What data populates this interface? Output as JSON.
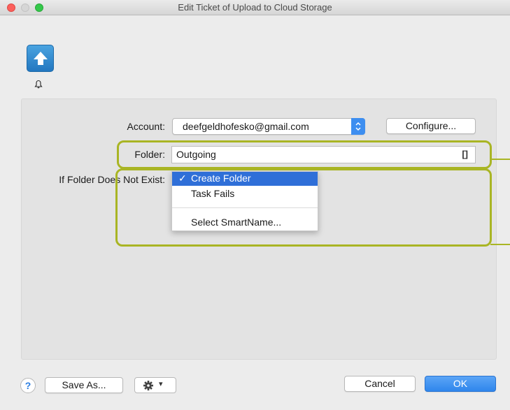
{
  "window": {
    "title": "Edit Ticket of Upload to Cloud Storage"
  },
  "icons": {
    "action": "upload-arrow-icon",
    "notification": "bell-icon",
    "help": "question-icon",
    "gear": "gear-icon"
  },
  "form": {
    "account": {
      "label": "Account:",
      "value": "deefgeldhofesko@gmail.com",
      "configure_label": "Configure..."
    },
    "folder": {
      "label": "Folder:",
      "value": "Outgoing",
      "placeholder_button": "[]"
    },
    "if_not_exist": {
      "label": "If Folder Does Not Exist:",
      "menu": {
        "selected_check": "✓",
        "items": [
          "Create Folder",
          "Task Fails",
          "Select SmartName..."
        ]
      }
    }
  },
  "footer": {
    "help_label": "?",
    "save_as_label": "Save As...",
    "gear_caret": "▾",
    "cancel_label": "Cancel",
    "ok_label": "OK"
  },
  "colors": {
    "highlight": "#a9b524",
    "accent": "#2f86ec",
    "menu_selection": "#2f6fd8"
  }
}
